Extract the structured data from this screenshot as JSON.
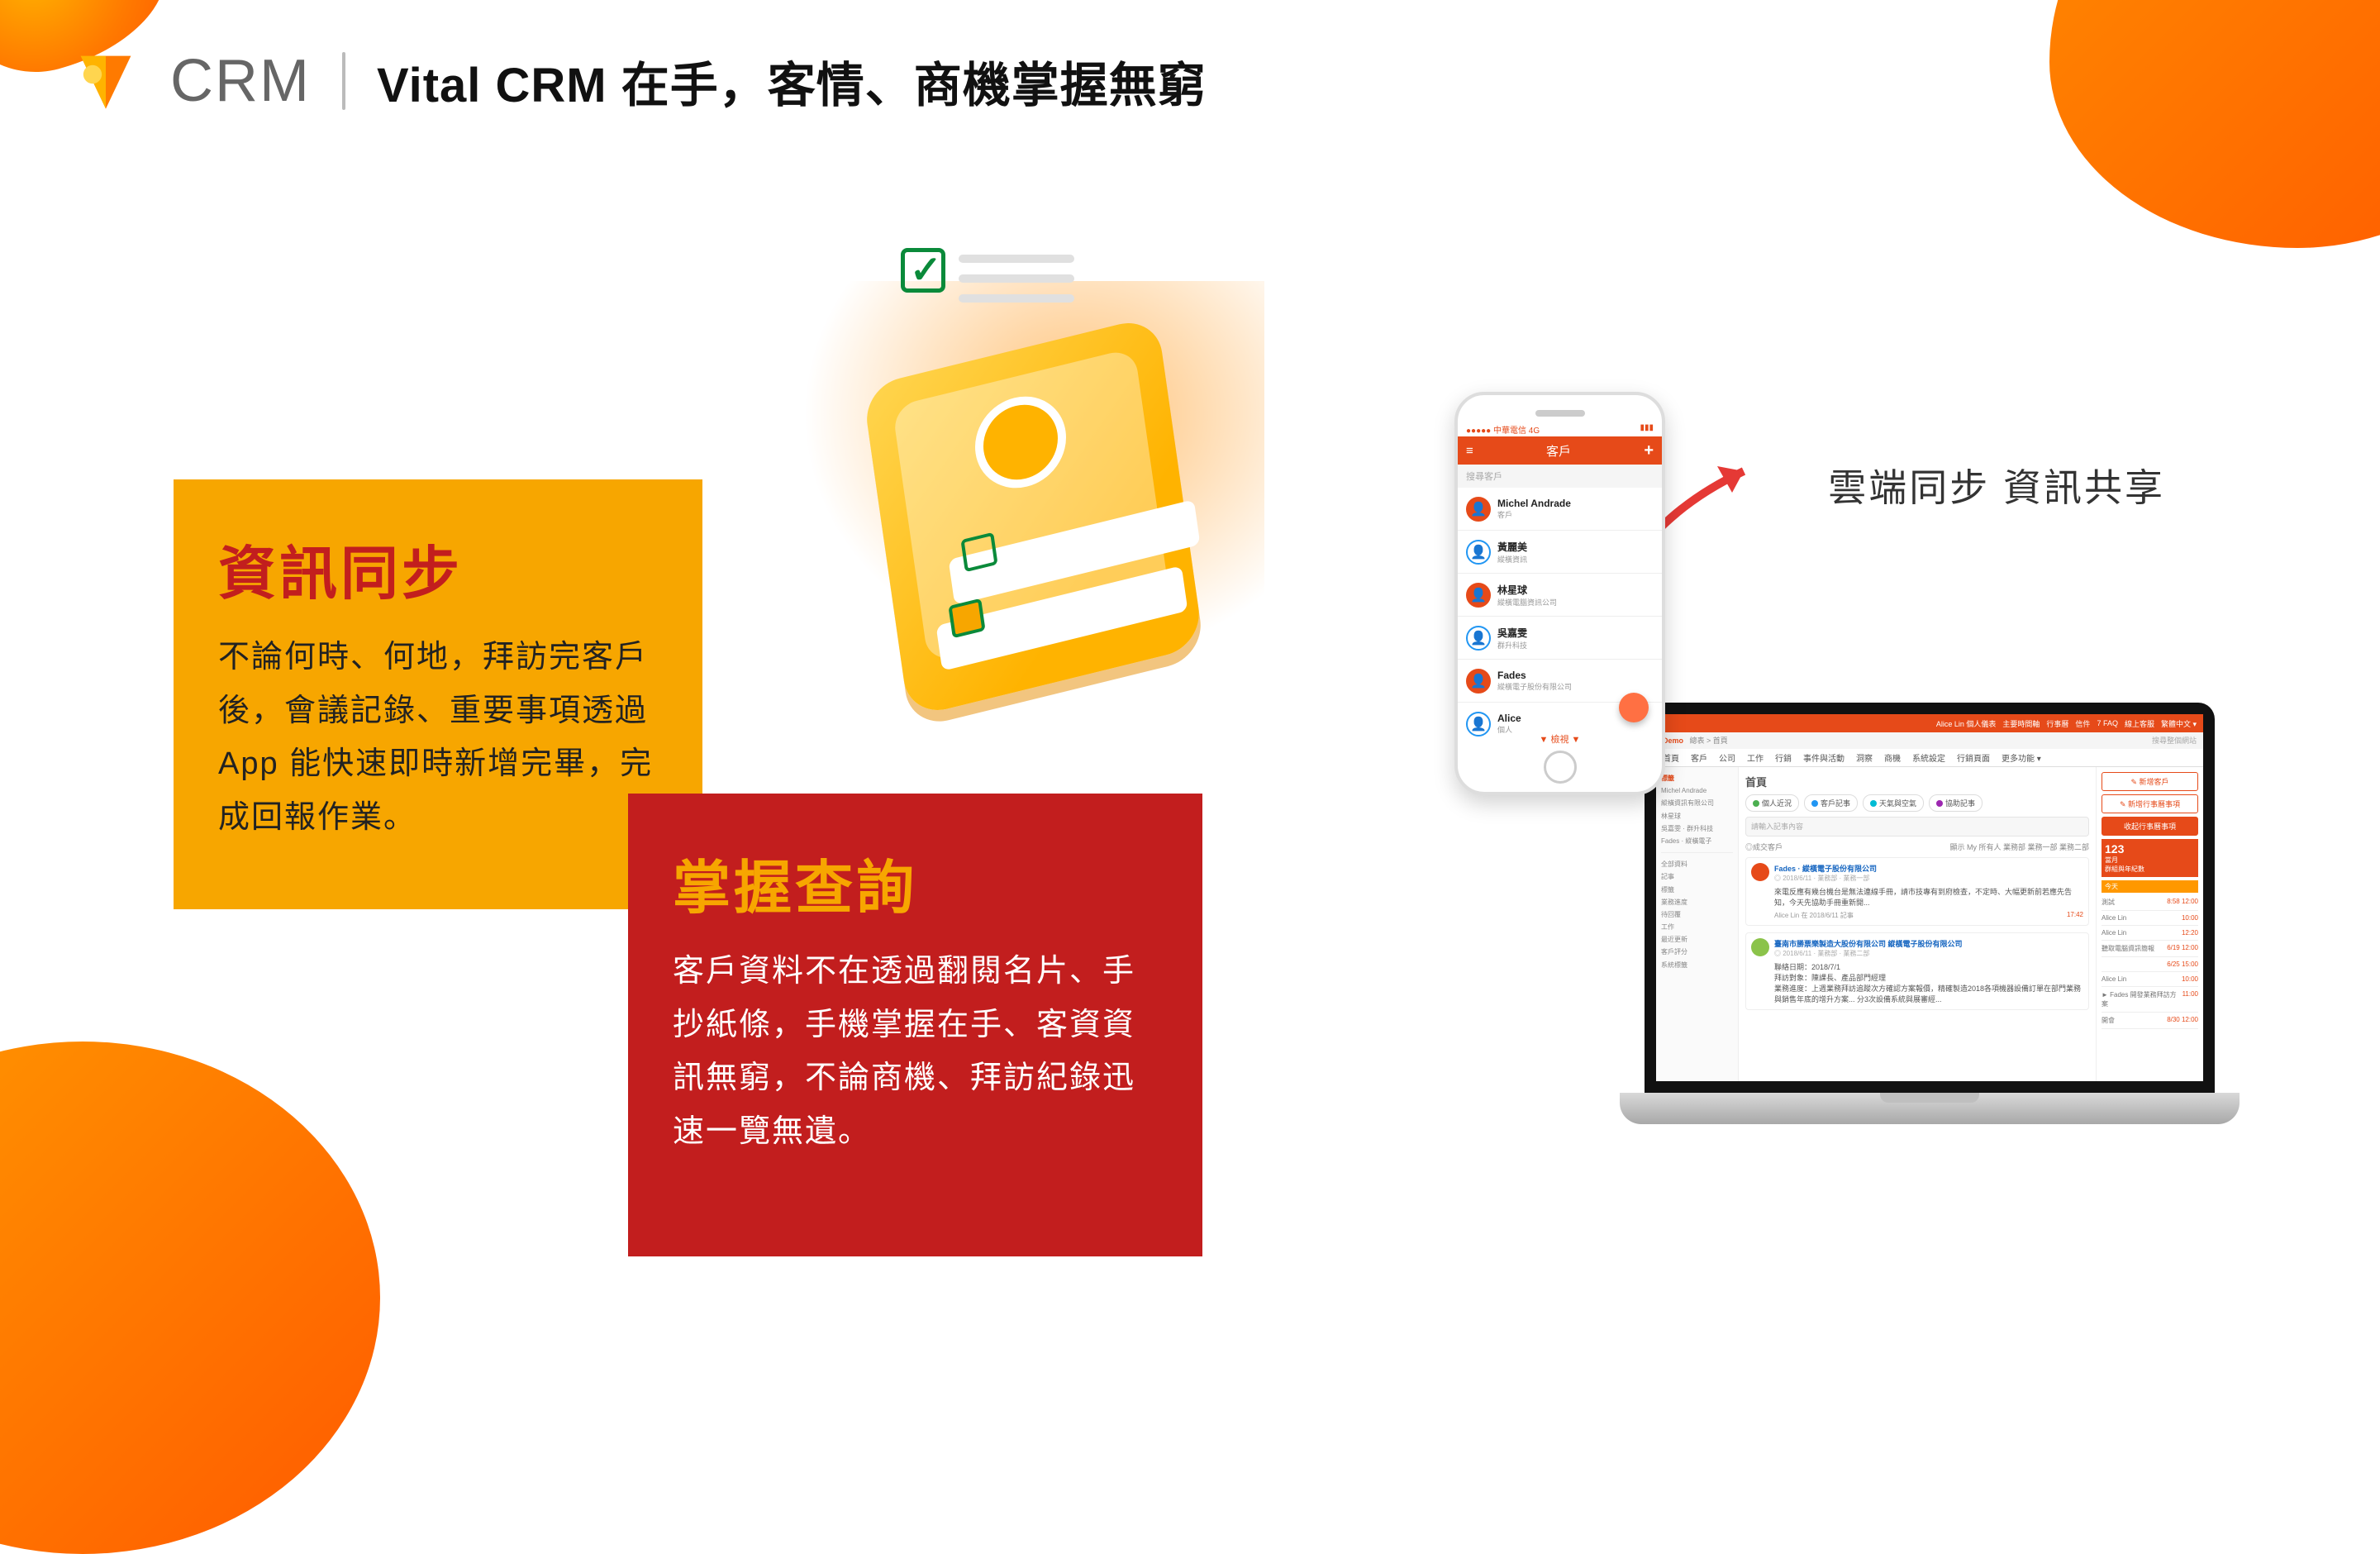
{
  "header": {
    "brand": "CRM",
    "title": "Vital CRM 在手，客情、商機掌握無窮"
  },
  "card_orange": {
    "heading": "資訊同步",
    "body": "不論何時、何地，拜訪完客戶後，會議記錄、重要事項透過 App 能快速即時新增完畢，完成回報作業。"
  },
  "card_red": {
    "heading": "掌握查詢",
    "body": "客戶資料不在透過翻閱名片、手抄紙條，手機掌握在手、客資資訊無窮，不論商機、拜訪紀錄迅速一覽無遺。"
  },
  "sync_label": "雲端同步 資訊共享",
  "phone_app": {
    "status_left": "●●●●● 中華電信 4G",
    "status_right": "▮▮▮",
    "appbar_title": "客戶",
    "appbar_left_icon": "menu",
    "appbar_right_icon": "+",
    "search_placeholder": "搜尋客戶",
    "footer": "▼ 檢視 ▼",
    "contacts": [
      {
        "name": "Michel Andrade",
        "sub": "客戶"
      },
      {
        "name": "黃麗美",
        "sub": "縱橫資訊"
      },
      {
        "name": "林星球",
        "sub": "縱橫電腦資訊公司"
      },
      {
        "name": "吳嘉雯",
        "sub": "群升科技"
      },
      {
        "name": "Fades",
        "sub": "縱橫電子股份有限公司"
      },
      {
        "name": "Alice",
        "sub": "個人"
      }
    ]
  },
  "laptop_app": {
    "brand": "Demo",
    "top_right_items": [
      "Alice Lin 個人儀表",
      "主要時間軸",
      "行事曆",
      "信件",
      "7 FAQ",
      "線上客服",
      "繁體中文 ▾"
    ],
    "breadcrumb": "總表 > 首頁",
    "search_small": "搜尋整個網站",
    "nav": [
      "首頁",
      "客戶",
      "公司",
      "工作",
      "行銷",
      "事件與活動",
      "洞察",
      "商機",
      "系統設定",
      "行銷頁面",
      "更多功能 ▾"
    ],
    "sidebar": {
      "section": "標籤",
      "items": [
        "Michel Andrade",
        "縱橫資訊有限公司",
        "林星球",
        "吳嘉雯 · 群升科技",
        "Fades · 縱橫電子"
      ],
      "filters": [
        "全部資料",
        "記事",
        "標籤",
        "業務進度",
        "待回覆",
        "工作",
        "最近更新",
        "客戶評分",
        "系統標籤"
      ]
    },
    "main": {
      "heading": "首頁",
      "tabs": [
        {
          "label": "個人近況",
          "color": "#4caf50"
        },
        {
          "label": "客戶記事",
          "color": "#2196f3"
        },
        {
          "label": "天氣與空氣",
          "color": "#00bcd4"
        },
        {
          "label": "協助記事",
          "color": "#9c27b0"
        }
      ],
      "search_placeholder": "請輸入記事內容",
      "filter_label": "◎成交客戶",
      "filter_right": "顯示 My 所有人 業務部 業務一部 業務二部",
      "posts": [
        {
          "author": "Fades · 縱橫電子股份有限公司",
          "meta": "◎ 2018/6/11 · 業務部 · 業務一部",
          "body": "來電反應有幾台機台是無法連線手冊，請市技專有到府檢查，不定時、大幅更新前若應先告知，今天先協助手冊重新開...",
          "tag": "Alice Lin 在 2018/6/11 記事",
          "time": "17:42"
        },
        {
          "author": "臺南市勝票樂製造大股份有限公司 縱橫電子股份有限公司",
          "meta": "◎ 2018/6/11 · 業務部 · 業務二部",
          "body": "聯絡日期：2018/7/1\n拜訪對象：陳課長、產品部門經理\n業務進度：上週業務拜訪追蹤次方確認方案報價，精確製造2018各項機器設備訂單在部門業務與銷售年底的增升方案... 分3次設備系統與展審經..."
        }
      ]
    },
    "right_panel": {
      "buttons": [
        "新增客戶",
        "新增行事曆事項"
      ],
      "calendar_head": "收起行事曆事項",
      "card": {
        "num": "123",
        "sub1": "當月",
        "sub2": "群組與年紀數"
      },
      "events_head": "今天",
      "events": [
        {
          "label": "測試",
          "time": "8:58 12:00"
        },
        {
          "label": "Alice Lin",
          "time": "10:00"
        },
        {
          "label": "Alice Lin",
          "time": "12:20"
        },
        {
          "label": "聽取電腦資訊簡報",
          "time": "6/19 12:00"
        },
        {
          "label": "",
          "time": "6/25 15:00"
        },
        {
          "label": "Alice Lin",
          "time": "10:00"
        },
        {
          "label": "► Fades 開發業務拜訪方案",
          "time": "11:00"
        },
        {
          "label": "開會",
          "time": "8/30 12:00"
        }
      ]
    }
  }
}
